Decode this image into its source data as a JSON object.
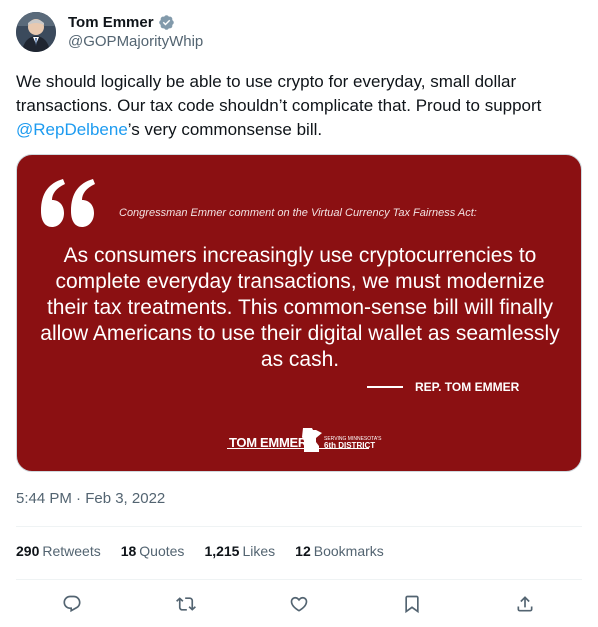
{
  "author": {
    "name": "Tom Emmer",
    "handle": "@GOPMajorityWhip",
    "verified": true
  },
  "tweet": {
    "text_before": "We should logically be able to use crypto for everyday, small dollar transactions. Our tax code shouldn’t complicate that. Proud to support ",
    "mention": "@RepDelbene",
    "text_after": "’s very commonsense bill."
  },
  "image": {
    "caption": "Congressman Emmer comment on the Virtual Currency Tax Fairness Act:",
    "quote": "As consumers increasingly use cryptocurrencies to complete everyday transactions, we must modernize their tax treatments. This common-sense bill will finally allow Americans to use their digital wallet as seamlessly as cash.",
    "attribution": "REP. TOM EMMER",
    "logo_name": "TOM EMMER",
    "logo_tagline": "SERVING MINNESOTA'S",
    "logo_district": "6th DISTRICT",
    "background_color": "#8b1012"
  },
  "timestamp": "5:44 PM · Feb 3, 2022",
  "stats": {
    "retweets_count": "290",
    "retweets_label": "Retweets",
    "quotes_count": "18",
    "quotes_label": "Quotes",
    "likes_count": "1,215",
    "likes_label": "Likes",
    "bookmarks_count": "12",
    "bookmarks_label": "Bookmarks"
  },
  "actions": [
    "reply-icon",
    "retweet-icon",
    "like-icon",
    "bookmark-icon",
    "share-icon"
  ],
  "colors": {
    "accent": "#1d9bf0",
    "text": "#0f1419",
    "muted": "#536471"
  }
}
